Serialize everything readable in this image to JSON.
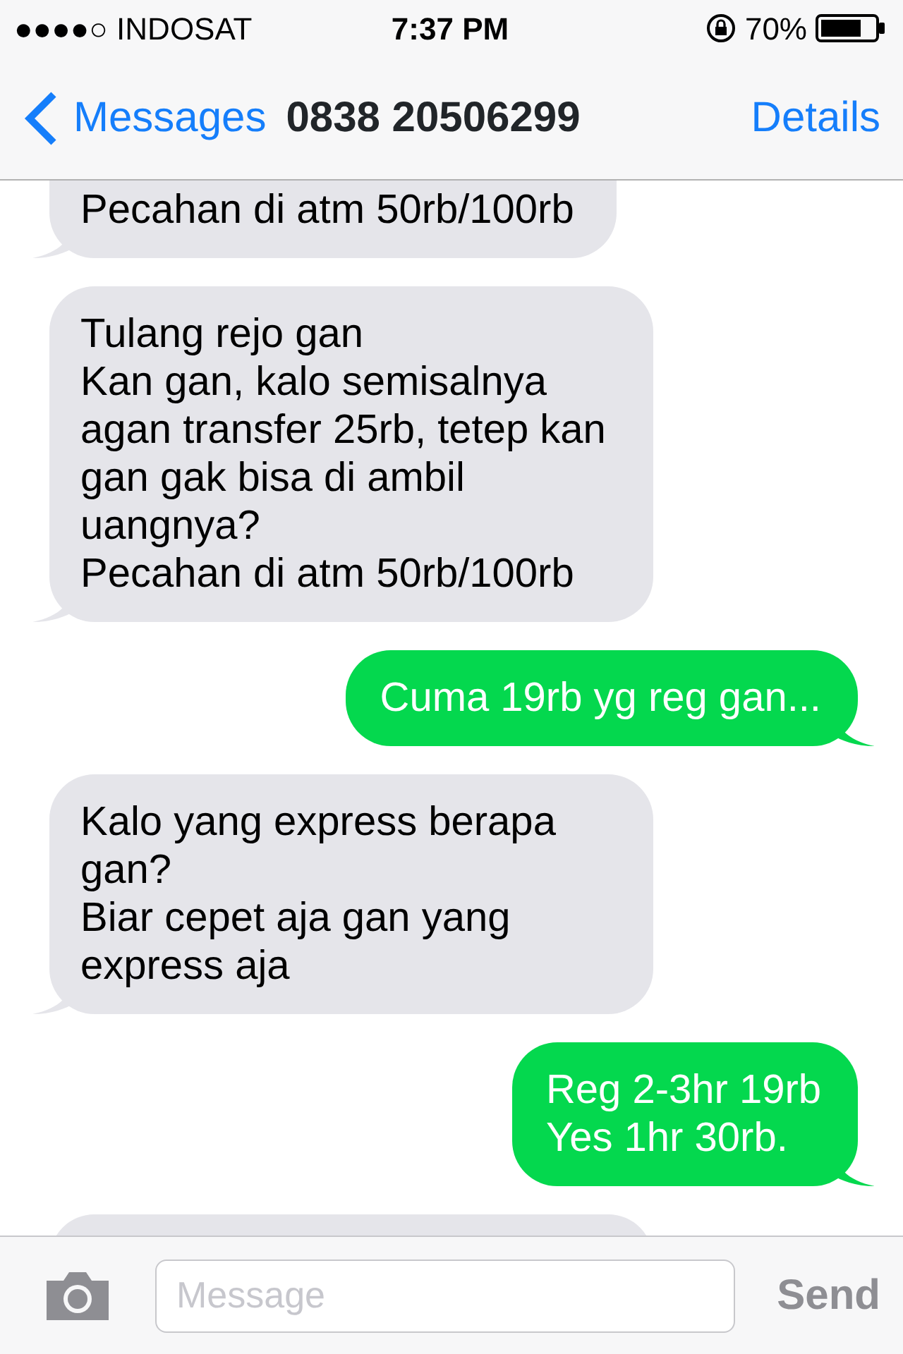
{
  "status_bar": {
    "carrier": "●●●●○ INDOSAT",
    "time": "7:37 PM",
    "battery": "70%"
  },
  "nav": {
    "back": "Messages",
    "title": "0838 20506299",
    "action": "Details"
  },
  "messages": [
    {
      "kind": "received",
      "text": "Pecahan di atm 50rb/100rb"
    },
    {
      "kind": "received",
      "text": "Tulang rejo gan\nKan gan, kalo semisalnya agan transfer 25rb, tetep kan gan gak bisa di ambil uangnya?\nPecahan di atm 50rb/100rb"
    },
    {
      "kind": "sent",
      "text": "Cuma 19rb yg reg gan..."
    },
    {
      "kind": "received",
      "text": "Kalo yang express berapa gan?\nBiar cepet aja gan yang express aja"
    },
    {
      "kind": "sent",
      "text": "Reg 2-3hr 19rb\nYes 1hr 30rb."
    },
    {
      "kind": "received"
    }
  ],
  "composer": {
    "placeholder": "Message",
    "send": "Send",
    "send_disabled": true
  }
}
